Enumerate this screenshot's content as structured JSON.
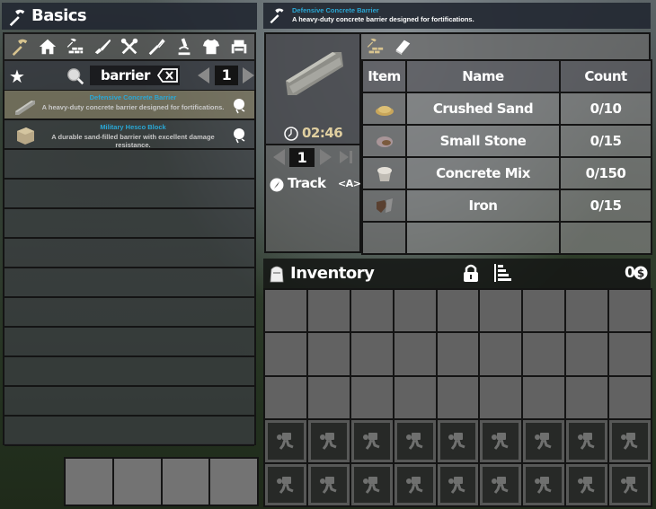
{
  "left_panel": {
    "title": "Basics",
    "title_icon": "hammer-icon",
    "categories": [
      {
        "name": "basics",
        "icon": "hammer-icon",
        "active": true
      },
      {
        "name": "building",
        "icon": "house-icon",
        "active": false
      },
      {
        "name": "resources",
        "icon": "hammer-bricks-icon",
        "active": false
      },
      {
        "name": "ammo-weapons",
        "icon": "knife-icon",
        "active": false
      },
      {
        "name": "tools",
        "icon": "wrench-screwdriver-icon",
        "active": false
      },
      {
        "name": "food",
        "icon": "fork-icon",
        "active": false
      },
      {
        "name": "science",
        "icon": "microscope-icon",
        "active": false
      },
      {
        "name": "clothing",
        "icon": "shirt-icon",
        "active": false
      },
      {
        "name": "decor",
        "icon": "armchair-icon",
        "active": false
      }
    ],
    "search": {
      "value": "barrier",
      "page": "1"
    },
    "recipes": [
      {
        "title": "Defensive Concrete Barrier",
        "description": "A heavy-duty concrete barrier designed for fortifications.",
        "selected": true,
        "icon": "concrete-barrier-icon"
      },
      {
        "title": "Military Hesco Block",
        "description": "A durable sand-filled barrier with excellent damage resistance.",
        "selected": false,
        "icon": "hesco-block-icon"
      }
    ],
    "empty_rows": 10,
    "toolbelt_slots": 4
  },
  "recipe_info": {
    "title": "Defensive Concrete Barrier",
    "description": "A heavy-duty concrete barrier designed for fortifications.",
    "craft_time": "02:46",
    "quantity": "1",
    "track_label": "Track",
    "track_key": "<A>"
  },
  "ingredients": {
    "headers": [
      "Item",
      "Name",
      "Count"
    ],
    "rows": [
      {
        "icon": "crushed-sand-icon",
        "name": "Crushed Sand",
        "count": "0/10"
      },
      {
        "icon": "small-stone-icon",
        "name": "Small Stone",
        "count": "0/15"
      },
      {
        "icon": "concrete-mix-icon",
        "name": "Concrete Mix",
        "count": "0/150"
      },
      {
        "icon": "iron-icon",
        "name": "Iron",
        "count": "0/15"
      },
      {
        "icon": "",
        "name": "",
        "count": ""
      }
    ]
  },
  "inventory": {
    "title": "Inventory",
    "coins": "0",
    "open_rows": 3,
    "locked_rows": 2,
    "columns": 9
  }
}
